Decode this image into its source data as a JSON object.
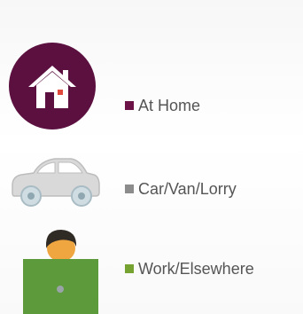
{
  "legend": {
    "items": [
      {
        "label": "At Home",
        "color": "#6b1246",
        "icon": "house-icon"
      },
      {
        "label": "Car/Van/Lorry",
        "color": "#8c8c8c",
        "icon": "car-icon"
      },
      {
        "label": "Work/Elsewhere",
        "color": "#76a232",
        "icon": "person-at-laptop-icon"
      }
    ]
  }
}
